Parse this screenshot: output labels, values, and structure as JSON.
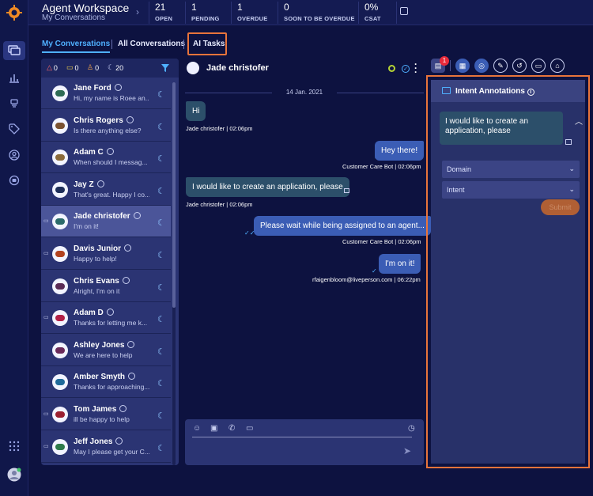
{
  "header": {
    "title": "Agent Workspace",
    "subtitle": "My Conversations",
    "stats": [
      {
        "value": "21",
        "label": "OPEN"
      },
      {
        "value": "1",
        "label": "PENDING"
      },
      {
        "value": "1",
        "label": "OVERDUE"
      },
      {
        "value": "0",
        "label": "SOON TO BE OVERDUE"
      },
      {
        "value": "0%",
        "label": "CSAT"
      }
    ]
  },
  "tabs": [
    {
      "label": "My Conversations",
      "active": true
    },
    {
      "label": "All Conversations",
      "active": false
    },
    {
      "label": "AI Tasks",
      "active": false
    }
  ],
  "filters": [
    {
      "icon": "alarm-icon",
      "count": "0"
    },
    {
      "icon": "chat-icon",
      "count": "0"
    },
    {
      "icon": "agents-icon",
      "count": "0"
    },
    {
      "icon": "moon-icon",
      "count": "20"
    }
  ],
  "conversations": [
    {
      "name": "Jane Ford",
      "snippet": "Hi, my name is Roee an...",
      "avatar_color": "#2e6b54",
      "note": false,
      "selected": false
    },
    {
      "name": "Chris Rogers",
      "snippet": "Is there anything else?",
      "avatar_color": "#7a5230",
      "note": false,
      "selected": false
    },
    {
      "name": "Adam C",
      "snippet": "When should I messag...",
      "avatar_color": "#8a6a3a",
      "note": false,
      "selected": false
    },
    {
      "name": "Jay Z",
      "snippet": "That's great. Happy I co...",
      "avatar_color": "#1f2f5a",
      "note": false,
      "selected": false
    },
    {
      "name": "Jade christofer",
      "snippet": "I'm on it!",
      "avatar_color": "#2b6a6a",
      "note": true,
      "selected": true
    },
    {
      "name": "Davis Junior",
      "snippet": "Happy to help!",
      "avatar_color": "#b2431f",
      "note": true,
      "selected": false
    },
    {
      "name": "Chris Evans",
      "snippet": "Alright, I'm on it",
      "avatar_color": "#5a2b55",
      "note": false,
      "selected": false
    },
    {
      "name": "Adam D",
      "snippet": "Thanks for letting me k...",
      "avatar_color": "#b22046",
      "note": true,
      "selected": false
    },
    {
      "name": "Ashley Jones",
      "snippet": "We are here to help",
      "avatar_color": "#6a2a5a",
      "note": false,
      "selected": false
    },
    {
      "name": "Amber Smyth",
      "snippet": "Thanks for approaching...",
      "avatar_color": "#1f6a9a",
      "note": false,
      "selected": false
    },
    {
      "name": "Tom James",
      "snippet": "ill be happy to help",
      "avatar_color": "#9a2030",
      "note": true,
      "selected": false
    },
    {
      "name": "Jeff Jones",
      "snippet": "May I please get your C...",
      "avatar_color": "#2e7a4a",
      "note": true,
      "selected": false
    }
  ],
  "chat": {
    "contact": "Jade christofer",
    "date": "14 Jan. 2021",
    "messages": [
      {
        "dir": "in",
        "text": "Hi",
        "sender": "Jade christofer",
        "time": "02:06pm"
      },
      {
        "dir": "out",
        "text": "Hey there!",
        "sender": "Customer Care Bot",
        "time": "02:06pm"
      },
      {
        "dir": "in",
        "text": "I would like to create an application, please",
        "sender": "Jade christofer",
        "time": "02:06pm"
      },
      {
        "dir": "out",
        "text": "Please wait while being assigned to an agent...",
        "sender": "Customer Care Bot",
        "time": "02:06pm"
      },
      {
        "dir": "out",
        "text": "I'm on it!",
        "sender": "rfaigenbloom@liveperson.com",
        "time": "06:22pm"
      }
    ]
  },
  "toolbar": {
    "badge_count": "1",
    "icons": [
      "notes-icon",
      "clipboard-icon",
      "compass-icon",
      "edit-icon",
      "history-icon",
      "id-card-icon",
      "store-icon"
    ]
  },
  "panel": {
    "title": "Intent Annotations",
    "message": "I would like to create an application, please",
    "domain_placeholder": "Domain",
    "intent_placeholder": "Intent",
    "submit_label": "Submit"
  },
  "colors": {
    "accent": "#4fb0ff",
    "highlight_box": "#e8743b",
    "inbound_bubble": "#2c4f6a",
    "outbound_bubble": "#3b5db5"
  }
}
